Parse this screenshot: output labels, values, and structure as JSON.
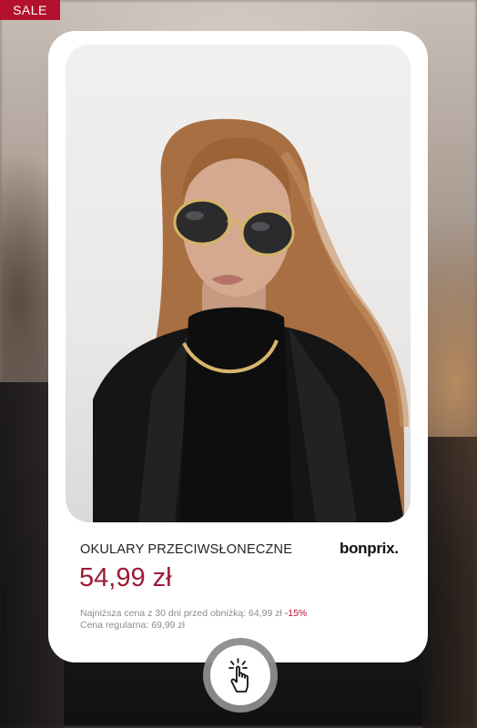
{
  "badge": {
    "label": "SALE"
  },
  "product": {
    "title": "OKULARY PRZECIWSŁONECZNE",
    "brand": "bonprix.",
    "price": "54,99 zł",
    "lowest_label": "Najniższa cena z 30 dni przed obniżką: 64,99 zł",
    "discount": "-15%",
    "regular": "Cena regularna: 69,99 zł"
  },
  "icons": {
    "tap": "hand-pointer-icon"
  },
  "colors": {
    "accent": "#b3112d",
    "price": "#9f1a35"
  }
}
